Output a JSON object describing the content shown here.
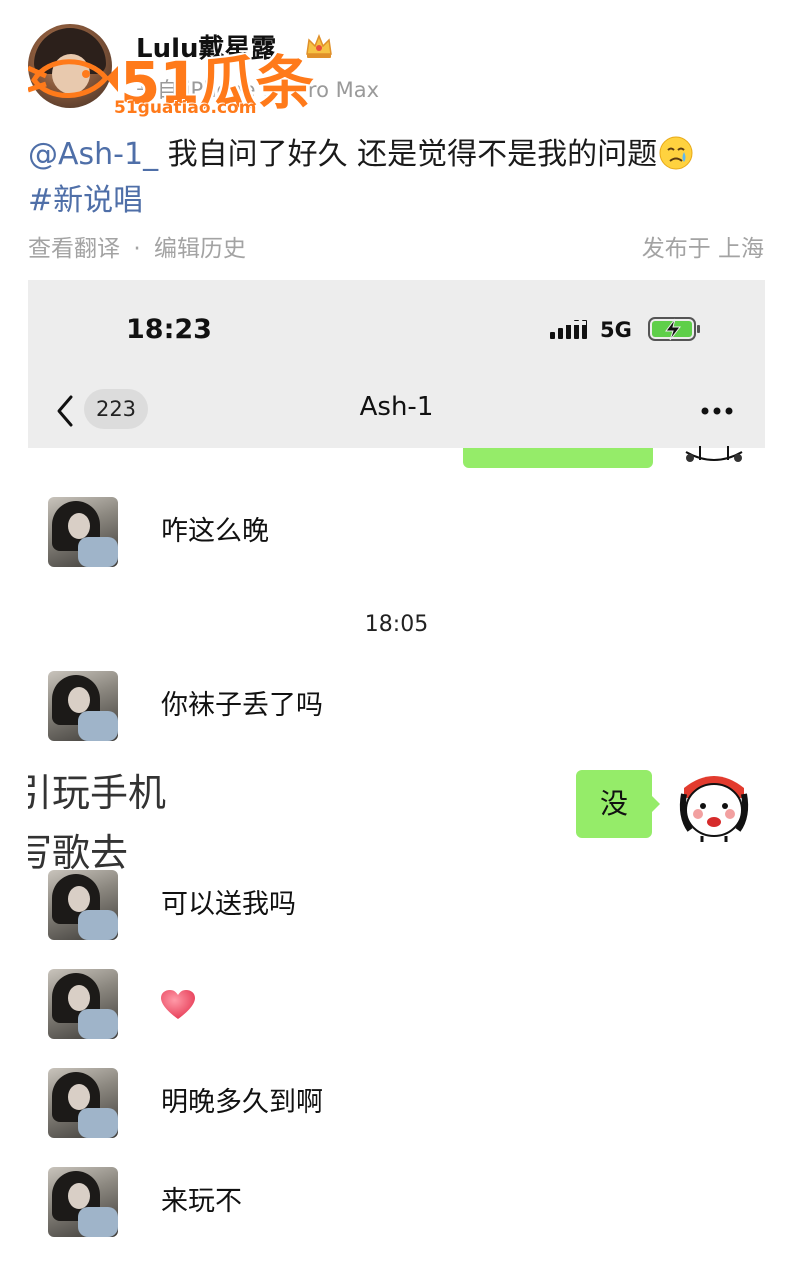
{
  "post": {
    "author": "Lulu戴星露",
    "meta": "来自 iPhone 14 Pro Max",
    "mention": "@Ash-1_",
    "text": " 我自问了好久 还是觉得不是我的问题",
    "hashtag": "#新说唱",
    "actions": [
      "查看翻译",
      "·",
      "编辑历史"
    ],
    "location": "发布于 上海"
  },
  "watermark": {
    "brand": "51瓜条",
    "url": "51guatiao.com"
  },
  "colors": {
    "link": "#4f6fa8",
    "bubble_mine": "#95ec69",
    "watermark": "#ff7a1a",
    "status_bg": "#ededed"
  },
  "chat": {
    "status_time": "18:23",
    "network": "5G",
    "back_badge": "223",
    "title": "Ash-1",
    "messages": [
      {
        "from": "them",
        "text": "咋这么晚"
      },
      {
        "type": "time",
        "text": "18:05"
      },
      {
        "from": "them",
        "text": "你袜子丢了吗"
      },
      {
        "from": "me",
        "text": "没"
      },
      {
        "from": "them",
        "text": "可以送我吗"
      },
      {
        "from": "them",
        "icon": "heart-icon"
      },
      {
        "from": "them",
        "text": "明晚多久到啊"
      },
      {
        "from": "them",
        "text": "来玩不"
      }
    ],
    "overlay_lines": [
      "引玩手机",
      "写歌去"
    ]
  }
}
